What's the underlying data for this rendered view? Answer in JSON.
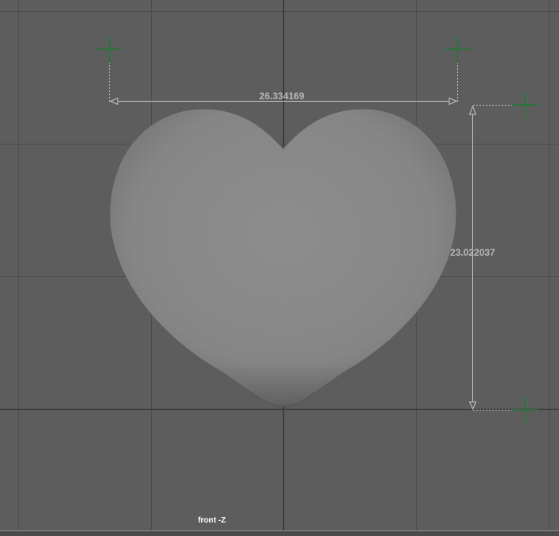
{
  "viewport": {
    "camera_label": "front -Z",
    "background_color": "#5d5d5d",
    "grid_color": "#4b4b4b",
    "axis_color": "#3a3a3a"
  },
  "model": {
    "shape": "heart-mesh",
    "color": "#8a8a8a"
  },
  "measurements": {
    "horizontal_distance": "26.334169",
    "vertical_distance": "23.022037",
    "locator_color": "#1f7a36",
    "line_color": "#c8c8c8"
  }
}
